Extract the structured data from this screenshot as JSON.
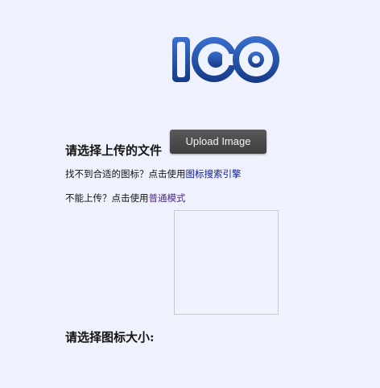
{
  "logo": {
    "text": "ICO",
    "colors": {
      "primary": "#2a57b8",
      "light": "#eef3ff",
      "dark": "#163a86"
    }
  },
  "upload_section": {
    "heading": "请选择上传的文件",
    "button_label": "Upload Image"
  },
  "help": {
    "line1_prefix": "找不到合适的图标？点击使用",
    "line1_link": "图标搜索引擎",
    "line2_prefix": "不能上传？点击使用",
    "line2_link": "普通模式"
  },
  "size_section": {
    "heading": "请选择图标大小:"
  },
  "colors": {
    "background": "#eff2fc",
    "button": "#4a4a4a",
    "link": "#0b18a0",
    "visited_link": "#4a2a8a"
  }
}
